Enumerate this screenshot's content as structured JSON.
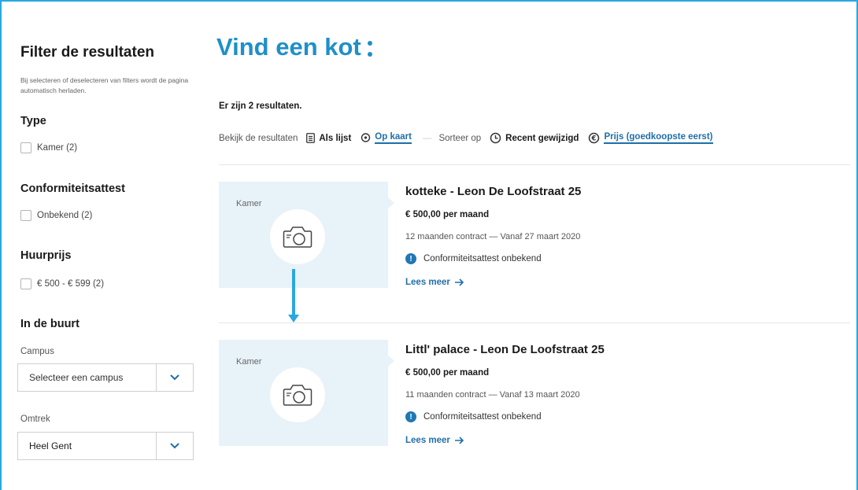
{
  "sidebar": {
    "title": "Filter de resultaten",
    "description": "Bij selecteren of deselecteren van filters wordt de pagina automatisch herladen.",
    "type": {
      "heading": "Type",
      "option": "Kamer (2)"
    },
    "conformity": {
      "heading": "Conformiteitsattest",
      "option": "Onbekend (2)"
    },
    "price": {
      "heading": "Huurprijs",
      "option": "€ 500 - € 599 (2)"
    },
    "nearby": {
      "heading": "In de buurt",
      "campus_label": "Campus",
      "campus_value": "Selecteer een campus",
      "area_label": "Omtrek",
      "area_value": "Heel Gent"
    }
  },
  "main": {
    "title": "Vind een kot",
    "result_count": "Er zijn 2 resultaten.",
    "toolbar": {
      "view_label": "Bekijk de resultaten",
      "list_label": "Als lijst",
      "map_label": "Op kaart",
      "separator": "—",
      "sort_label": "Sorteer op",
      "sort_recent": "Recent gewijzigd",
      "sort_price": "Prijs (goedkoopste eerst)"
    },
    "listings": [
      {
        "type": "Kamer",
        "title": "kotteke - Leon De Loofstraat 25",
        "price": "€ 500,00 per maand",
        "contract": "12 maanden contract — Vanaf 27 maart 2020",
        "conformity": "Conformiteitsattest onbekend",
        "more": "Lees meer"
      },
      {
        "type": "Kamer",
        "title": "Littl' palace - Leon De Loofstraat 25",
        "price": "€ 500,00 per maand",
        "contract": "11 maanden contract — Vanaf 13 maart 2020",
        "conformity": "Conformiteitsattest onbekend",
        "more": "Lees meer"
      }
    ]
  },
  "colors": {
    "accent": "#1f8fc9",
    "link": "#1f6fa8",
    "thumb_bg": "#e8f2f9",
    "connector": "#29a8e0"
  }
}
